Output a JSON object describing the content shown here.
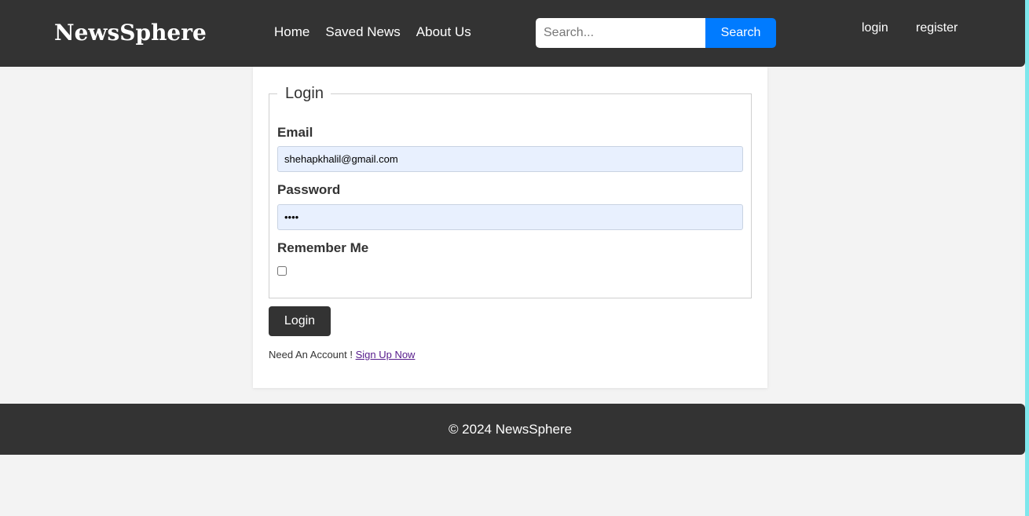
{
  "header": {
    "brand": "NewsSphere",
    "nav": [
      "Home",
      "Saved News",
      "About Us"
    ],
    "search_placeholder": "Search...",
    "search_button": "Search",
    "login_link": "login",
    "register_link": "register"
  },
  "login_form": {
    "legend": "Login",
    "email_label": "Email",
    "email_value": "shehapkhalil@gmail.com",
    "password_label": "Password",
    "password_value": "••••",
    "remember_label": "Remember Me",
    "remember_checked": false,
    "submit_label": "Login",
    "account_prompt": "Need An Account !",
    "signup_link": "Sign Up Now"
  },
  "footer": {
    "copyright": "© 2024 NewsSphere"
  },
  "colors": {
    "header_bg": "#333333",
    "page_bg": "#f3f3f3",
    "search_button_bg": "#007bff",
    "input_autofill_bg": "#e8f0fe",
    "visited_link": "#551a8b",
    "edge_strip": "#7ee7ec"
  }
}
